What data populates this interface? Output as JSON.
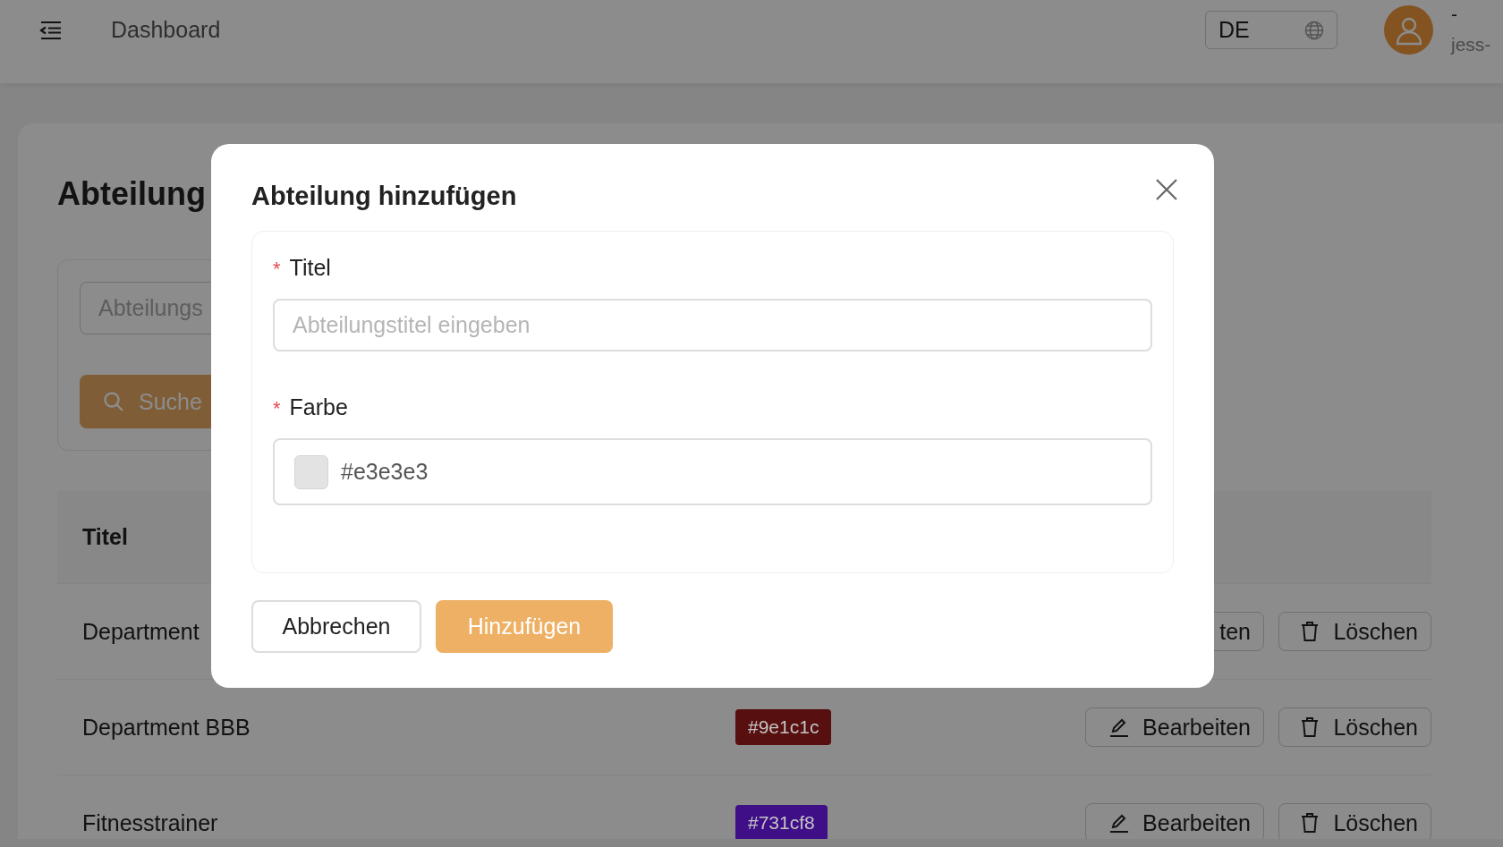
{
  "topbar": {
    "title": "Dashboard",
    "language": "DE",
    "user": {
      "name": "-",
      "email": "jess-"
    }
  },
  "page": {
    "heading": "Abteilung",
    "search": {
      "placeholder": "Abteilungs",
      "button": "Suche"
    },
    "table": {
      "columns": [
        "Titel"
      ],
      "rows": [
        {
          "title": "Department",
          "actions": [
            {
              "kind": "edit",
              "label": "ten"
            },
            {
              "kind": "delete",
              "label": "Löschen"
            }
          ]
        },
        {
          "title": "Department BBB",
          "tag": "#9e1c1c",
          "color": "#570f0f",
          "actions": [
            {
              "kind": "edit",
              "label": "Bearbeiten"
            },
            {
              "kind": "delete",
              "label": "Löschen"
            }
          ]
        },
        {
          "title": "Fitnesstrainer",
          "tag": "#731cf8",
          "color": "#3f0f88",
          "actions": [
            {
              "kind": "edit",
              "label": "Bearbeiten"
            },
            {
              "kind": "delete",
              "label": "Löschen"
            }
          ]
        }
      ]
    }
  },
  "modal": {
    "title": "Abteilung hinzufügen",
    "required_mark": "*",
    "fields": [
      {
        "kind": "text",
        "label": "Titel",
        "required": true,
        "placeholder": "Abteilungstitel eingeben"
      },
      {
        "kind": "color",
        "label": "Farbe",
        "required": true,
        "value": "#e3e3e3",
        "color": "#e3e3e3"
      }
    ],
    "buttons": [
      {
        "kind": "secondary",
        "label": "Abbrechen"
      },
      {
        "kind": "primary",
        "label": "Hinzufügen"
      }
    ]
  }
}
